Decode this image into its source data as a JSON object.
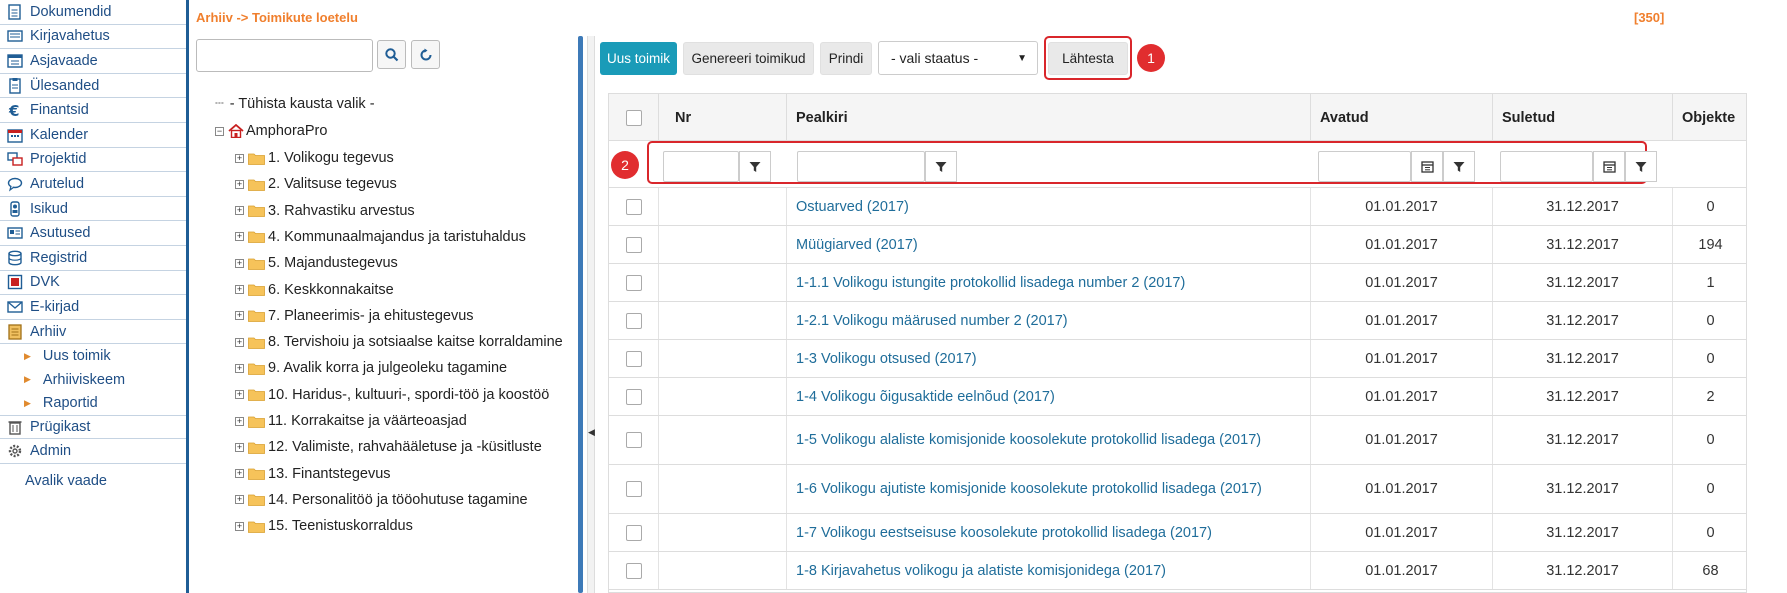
{
  "nav": {
    "items": [
      {
        "label": "Dokumendid",
        "icon": "document-icon"
      },
      {
        "label": "Kirjavahetus",
        "icon": "correspondence-icon"
      },
      {
        "label": "Asjavaade",
        "icon": "case-view-icon"
      },
      {
        "label": "Ülesanded",
        "icon": "tasks-icon"
      },
      {
        "label": "Finantsid",
        "icon": "euro-icon"
      },
      {
        "label": "Kalender",
        "icon": "calendar-icon"
      },
      {
        "label": "Projektid",
        "icon": "projects-icon"
      },
      {
        "label": "Arutelud",
        "icon": "discussion-icon"
      },
      {
        "label": "Isikud",
        "icon": "person-icon"
      },
      {
        "label": "Asutused",
        "icon": "institution-icon"
      },
      {
        "label": "Registrid",
        "icon": "database-icon"
      },
      {
        "label": "DVK",
        "icon": "dvk-icon"
      },
      {
        "label": "E-kirjad",
        "icon": "email-icon"
      },
      {
        "label": "Arhiiv",
        "icon": "archive-icon"
      }
    ],
    "archive_sub": [
      "Uus toimik",
      "Arhiiviskeem",
      "Raportid"
    ],
    "bottom_items": [
      {
        "label": "Prügikast",
        "icon": "trash-icon"
      },
      {
        "label": "Admin",
        "icon": "gear-icon"
      }
    ],
    "public_view": "Avalik vaade"
  },
  "breadcrumb": "Arhiiv -> Toimikute loetelu",
  "count": "[350]",
  "tree": {
    "clear_label": "- Tühista kausta valik -",
    "root": "AmphoraPro",
    "folders": [
      "1. Volikogu tegevus",
      "2. Valitsuse tegevus",
      "3. Rahvastiku arvestus",
      "4. Kommunaalmajandus ja taristuhaldus",
      "5. Majandustegevus",
      "6. Keskkonnakaitse",
      "7. Planeerimis- ja ehitustegevus",
      "8. Tervishoiu ja sotsiaalse kaitse korraldamine",
      "9. Avalik korra ja julgeoleku tagamine",
      "10. Haridus-, kultuuri-, spordi-töö ja koostöö",
      "11. Korrakaitse ja väärteoasjad",
      "12. Valimiste, rahvahääletuse ja -küsitluste",
      "13. Finantstegevus",
      "14. Personalitöö ja tööohutuse tagamine",
      "15. Teenistuskorraldus"
    ]
  },
  "toolbar": {
    "new_label": "Uus toimik",
    "generate_label": "Genereeri toimikud",
    "print_label": "Prindi",
    "status_placeholder": "- vali staatus -",
    "reset_label": "Lähtesta",
    "badge1": "1",
    "badge2": "2"
  },
  "table": {
    "headers": {
      "nr": "Nr",
      "title": "Pealkiri",
      "opened": "Avatud",
      "closed": "Suletud",
      "objects": "Objekte"
    },
    "rows": [
      {
        "title": "Ostuarved (2017)",
        "opened": "01.01.2017",
        "closed": "31.12.2017",
        "objects": "0"
      },
      {
        "title": "Müügiarved (2017)",
        "opened": "01.01.2017",
        "closed": "31.12.2017",
        "objects": "194"
      },
      {
        "title": "1-1.1 Volikogu istungite protokollid lisadega number 2 (2017)",
        "opened": "01.01.2017",
        "closed": "31.12.2017",
        "objects": "1"
      },
      {
        "title": "1-2.1 Volikogu määrused number 2 (2017)",
        "opened": "01.01.2017",
        "closed": "31.12.2017",
        "objects": "0"
      },
      {
        "title": "1-3 Volikogu otsused (2017)",
        "opened": "01.01.2017",
        "closed": "31.12.2017",
        "objects": "0"
      },
      {
        "title": "1-4 Volikogu õigusaktide eelnõud (2017)",
        "opened": "01.01.2017",
        "closed": "31.12.2017",
        "objects": "2"
      },
      {
        "title": "1-5 Volikogu alaliste komisjonide koosolekute protokollid lisadega (2017)",
        "opened": "01.01.2017",
        "closed": "31.12.2017",
        "objects": "0"
      },
      {
        "title": "1-6 Volikogu ajutiste komisjonide koosolekute protokollid lisadega (2017)",
        "opened": "01.01.2017",
        "closed": "31.12.2017",
        "objects": "0"
      },
      {
        "title": "1-7 Volikogu eestseisuse koosolekute protokollid lisadega (2017)",
        "opened": "01.01.2017",
        "closed": "31.12.2017",
        "objects": "0"
      },
      {
        "title": "1-8 Kirjavahetus volikogu ja alatiste komisjonidega (2017)",
        "opened": "01.01.2017",
        "closed": "31.12.2017",
        "objects": "68"
      }
    ]
  },
  "colors": {
    "brand": "#1f5d95",
    "accent": "#1a9bb8",
    "highlight": "#d9262b",
    "breadcrumb": "#f07f2d",
    "link": "#1f6d9a"
  }
}
